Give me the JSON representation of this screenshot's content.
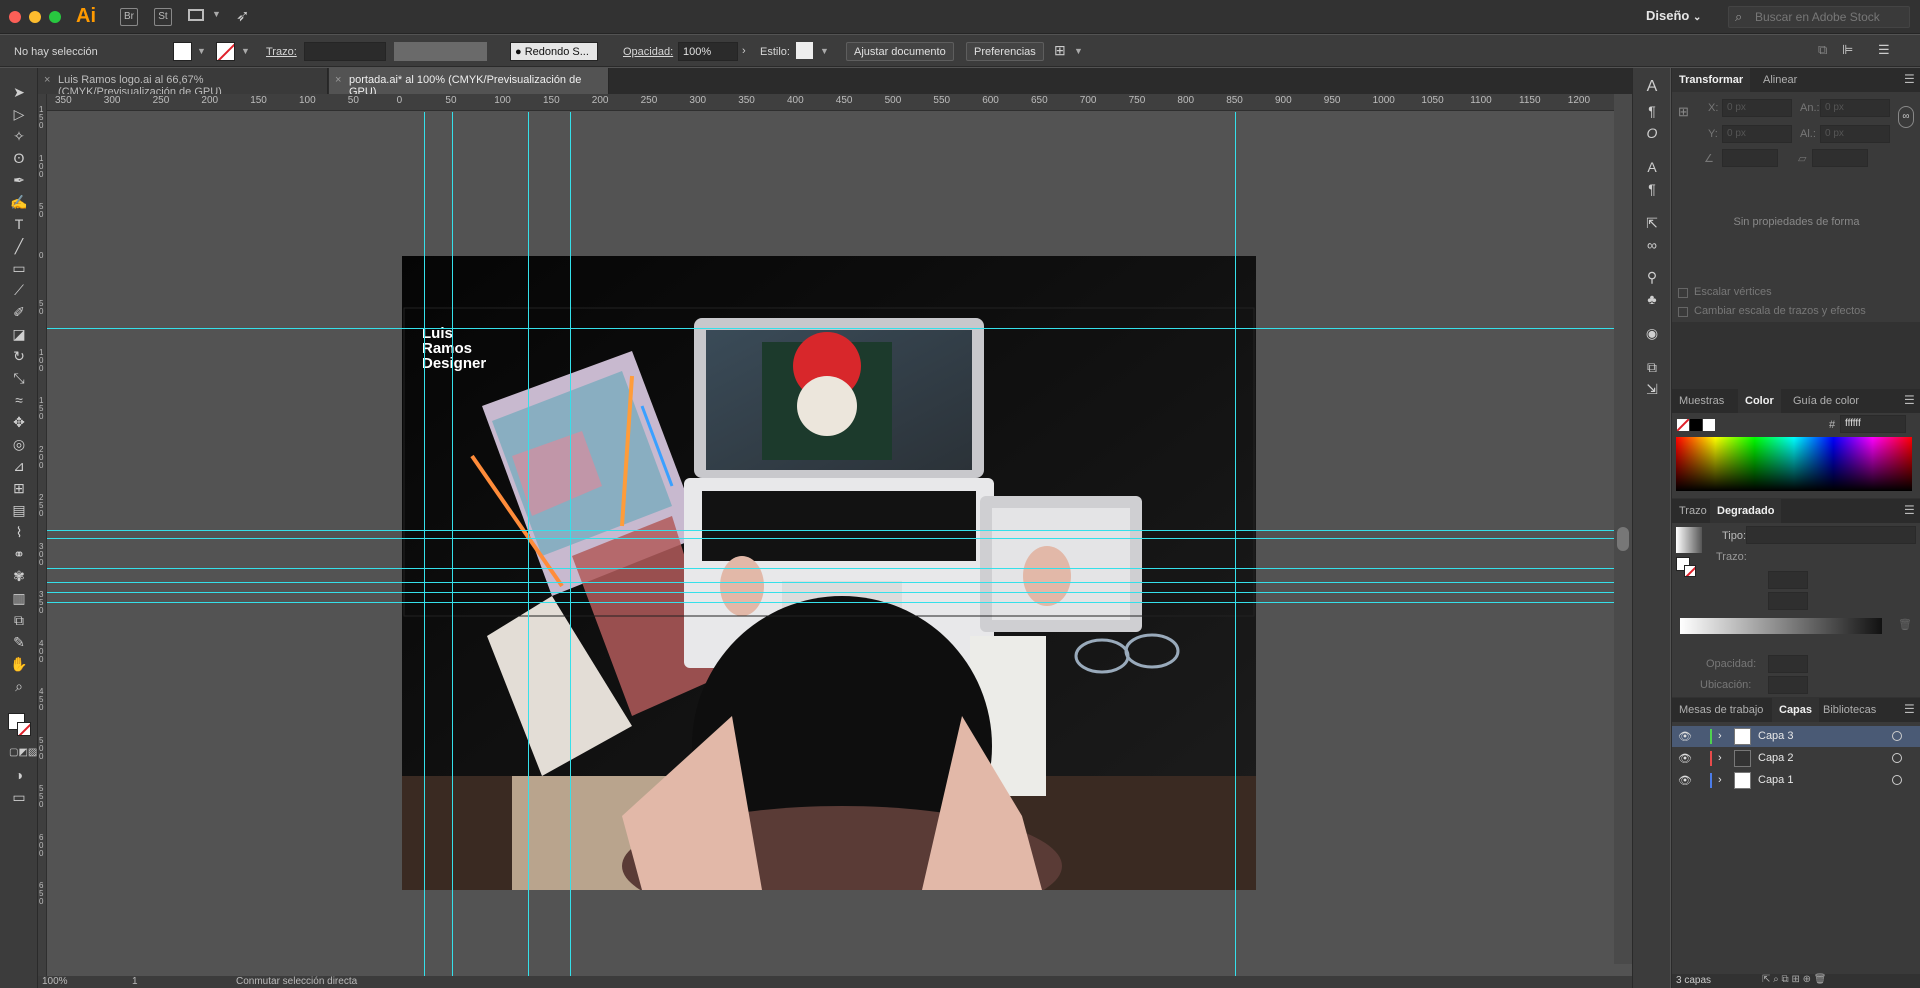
{
  "app": {
    "logo": "Ai",
    "bridge": "Br",
    "stock": "St"
  },
  "workspace": {
    "label": "Diseño"
  },
  "search": {
    "placeholder": "Buscar en Adobe Stock"
  },
  "control_bar": {
    "selection": "No hay selección",
    "stroke_label": "Trazo:",
    "brush": "Redondo S...",
    "opacity_label": "Opacidad:",
    "opacity_value": "100%",
    "style_label": "Estilo:",
    "adjust_button": "Ajustar documento",
    "prefs_button": "Preferencias"
  },
  "tabs": [
    {
      "label": "Luis Ramos logo.ai al 66,67% (CMYK/Previsualización de GPU)"
    },
    {
      "label": "portada.ai* al 100% (CMYK/Previsualización de GPU)"
    }
  ],
  "ruler_h": [
    "350",
    "300",
    "250",
    "200",
    "150",
    "100",
    "50",
    "0",
    "50",
    "100",
    "150",
    "200",
    "250",
    "300",
    "350",
    "400",
    "450",
    "500",
    "550",
    "600",
    "650",
    "700",
    "750",
    "800",
    "850",
    "900",
    "950",
    "1000",
    "1050",
    "1100",
    "1150",
    "1200"
  ],
  "ruler_v": [
    "1\n5\n0",
    "1\n0\n0",
    "5\n0",
    "0",
    "5\n0",
    "1\n0\n0",
    "1\n5\n0",
    "2\n0\n0",
    "2\n5\n0",
    "3\n0\n0",
    "3\n5\n0",
    "4\n0\n0",
    "4\n5\n0",
    "5\n0\n0",
    "5\n5\n0",
    "6\n0\n0",
    "6\n5\n0"
  ],
  "artboard": {
    "title_lines": [
      "Luis",
      "Ramos",
      "Designer"
    ]
  },
  "transform_panel": {
    "tab_active": "Transformar",
    "tab_other": "Alinear",
    "x_label": "X:",
    "y_label": "Y:",
    "w_label": "An.:",
    "h_label": "Al.:",
    "x_value": "0 px",
    "y_value": "0 px",
    "w_value": "0 px",
    "h_value": "0 px",
    "empty_message": "Sin propiedades de forma",
    "scale_corners": "Escalar vértices",
    "scale_strokes": "Cambiar escala de trazos y efectos"
  },
  "color_panel": {
    "tabs": [
      "Muestras",
      "Color",
      "Guía de color"
    ],
    "active": "Color",
    "hex_symbol": "#",
    "hex": "ffffff"
  },
  "gradient_panel": {
    "tabs": [
      "Trazo",
      "Degradado"
    ],
    "active": "Degradado",
    "type_label": "Tipo:",
    "stroke_label": "Trazo:",
    "opacity_label": "Opacidad:",
    "location_label": "Ubicación:"
  },
  "layers_panel": {
    "tabs": [
      "Mesas de trabajo",
      "Capas",
      "Bibliotecas"
    ],
    "active": "Capas",
    "layers": [
      {
        "name": "Capa 3",
        "color": "#4fd14f"
      },
      {
        "name": "Capa 2",
        "color": "#e84b4b"
      },
      {
        "name": "Capa 1",
        "color": "#4b7ce8"
      }
    ],
    "count": "3 capas"
  },
  "status": {
    "zoom": "100%",
    "artboard_num": "1",
    "tool_hint": "Conmutar selección directa"
  }
}
